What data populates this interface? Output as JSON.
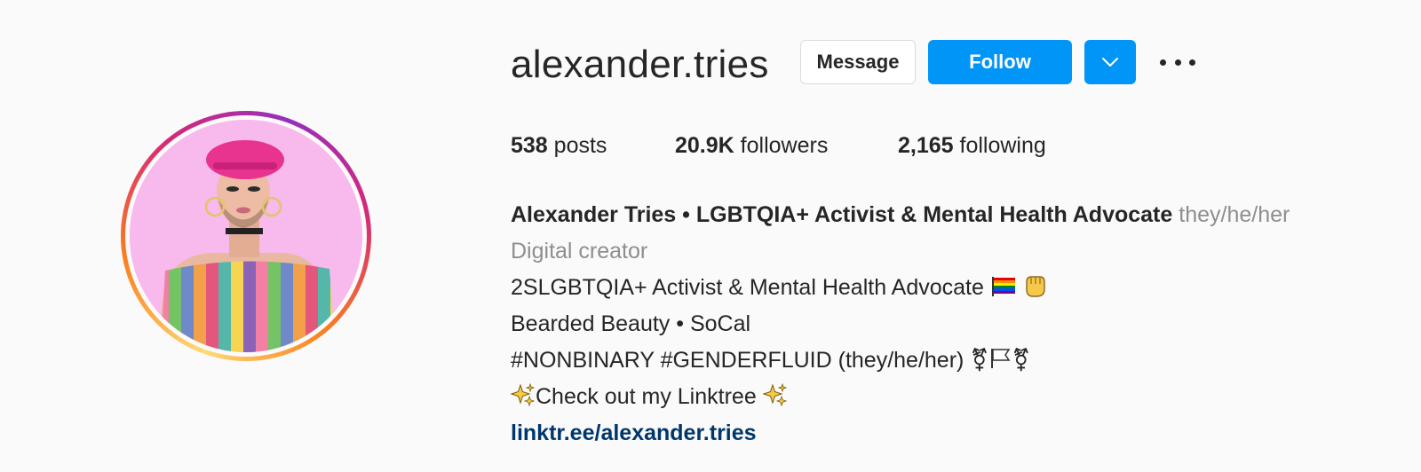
{
  "profile": {
    "username": "alexander.tries",
    "actions": {
      "message_label": "Message",
      "follow_label": "Follow"
    },
    "stats": [
      {
        "value": "538",
        "label": "posts"
      },
      {
        "value": "20.9K",
        "label": "followers"
      },
      {
        "value": "2,165",
        "label": "following"
      }
    ],
    "bio": {
      "full_name": "Alexander Tries • LGBTQIA+ Activist & Mental Health Advocate",
      "pronouns": "they/he/her",
      "category": "Digital creator",
      "lines": [
        "2SLGBTQIA+ Activist & Mental Health Advocate",
        "Bearded Beauty • SoCal",
        "#NONBINARY #GENDERFLUID (they/he/her)",
        "Check out my Linktree"
      ],
      "link": "linktr.ee/alexander.tries"
    }
  },
  "icons": {
    "dropdown": "chevron-down-icon",
    "more": "more-options-icon",
    "rainbow_flag": "rainbow-flag-icon",
    "fist": "raised-fist-icon",
    "transgender": "transgender-symbol-icon",
    "white_flag": "white-flag-icon",
    "sparkles": "sparkles-icon"
  },
  "colors": {
    "follow_blue": "#0095f6",
    "link_blue": "#00376b",
    "muted_gray": "#8e8e8e",
    "text": "#262626"
  }
}
